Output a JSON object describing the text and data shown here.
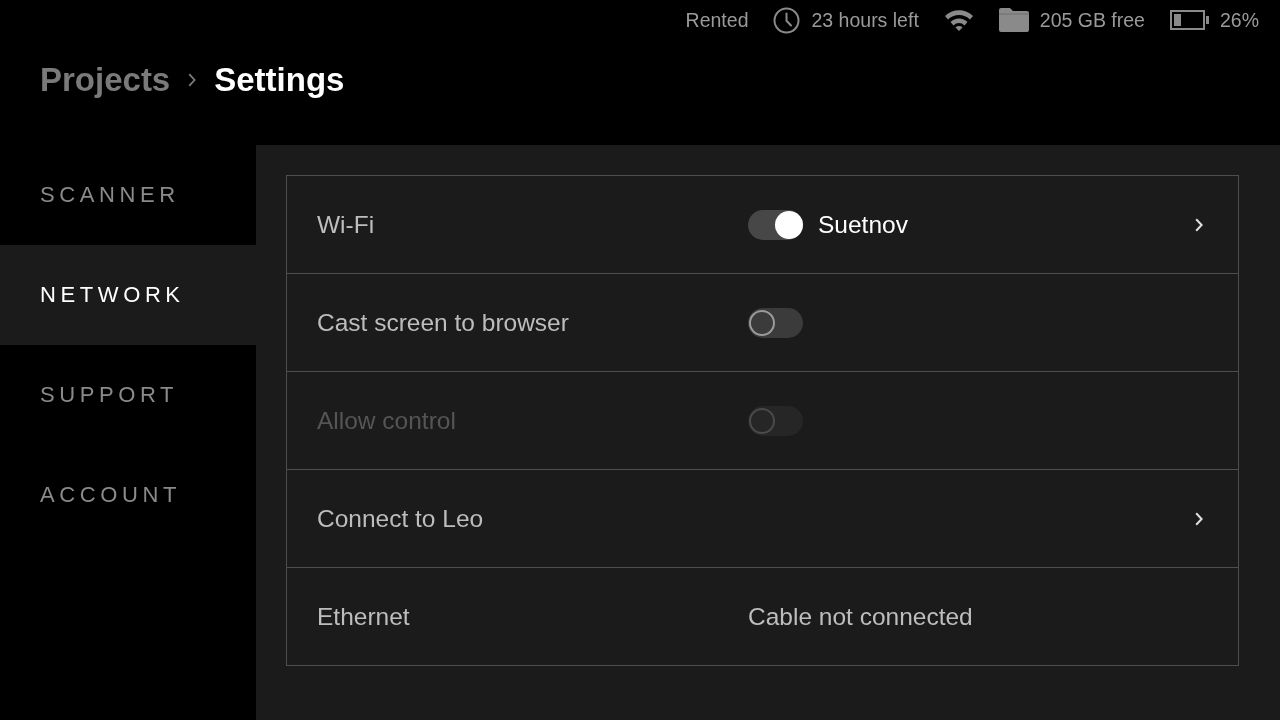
{
  "status_bar": {
    "rental": "Rented",
    "time_left": "23 hours left",
    "storage": "205 GB free",
    "battery": "26%"
  },
  "breadcrumb": [
    {
      "label": "Projects",
      "current": false
    },
    {
      "label": "Settings",
      "current": true
    }
  ],
  "sidebar": {
    "items": [
      {
        "label": "SCANNER",
        "selected": false
      },
      {
        "label": "NETWORK",
        "selected": true
      },
      {
        "label": "SUPPORT",
        "selected": false
      },
      {
        "label": "ACCOUNT",
        "selected": false
      }
    ]
  },
  "settings": {
    "rows": [
      {
        "kind": "switch",
        "label": "Wi-Fi",
        "on": true,
        "disabled": false,
        "value": "Suetnov",
        "chevron": true
      },
      {
        "kind": "switch",
        "label": "Cast screen to browser",
        "on": false,
        "disabled": false,
        "chevron": false
      },
      {
        "kind": "switch",
        "label": "Allow control",
        "on": false,
        "disabled": true,
        "chevron": false
      },
      {
        "kind": "link",
        "label": "Connect to Leo",
        "disabled": false,
        "chevron": true
      },
      {
        "kind": "info",
        "label": "Ethernet",
        "disabled": false,
        "value": "Cable not connected",
        "chevron": false
      }
    ]
  }
}
